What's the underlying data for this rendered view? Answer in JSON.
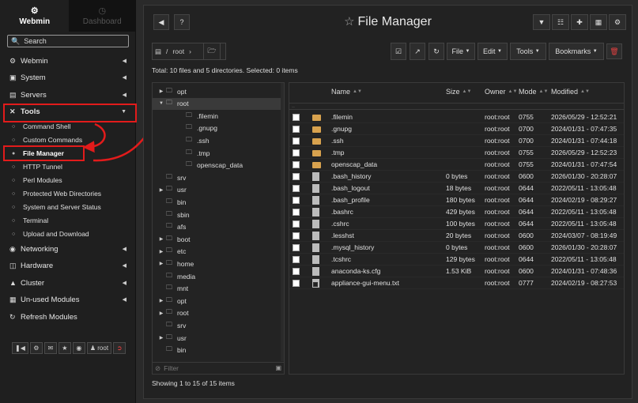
{
  "sidebar": {
    "tabs": [
      {
        "label": "Webmin",
        "icon": "webmin-icon"
      },
      {
        "label": "Dashboard",
        "icon": "dashboard-icon"
      }
    ],
    "search_placeholder": "Search",
    "menu": [
      {
        "label": "Webmin",
        "icon": "gear-icon"
      },
      {
        "label": "System",
        "icon": "monitor-icon"
      },
      {
        "label": "Servers",
        "icon": "server-icon"
      },
      {
        "label": "Tools",
        "icon": "tools-icon"
      },
      {
        "label": "Networking",
        "icon": "network-icon"
      },
      {
        "label": "Hardware",
        "icon": "hardware-icon"
      },
      {
        "label": "Cluster",
        "icon": "cluster-icon"
      },
      {
        "label": "Un-used Modules",
        "icon": "unused-icon"
      },
      {
        "label": "Refresh Modules",
        "icon": "refresh-icon"
      }
    ],
    "tools_items": [
      "Command Shell",
      "Custom Commands",
      "File Manager",
      "HTTP Tunnel",
      "Perl Modules",
      "Protected Web Directories",
      "System and Server Status",
      "Terminal",
      "Upload and Download"
    ],
    "bottom_user": "root"
  },
  "header": {
    "title": "File Manager"
  },
  "breadcrumb": {
    "path": "root"
  },
  "toolbar": {
    "file": "File",
    "edit": "Edit",
    "tools": "Tools",
    "bookmarks": "Bookmarks"
  },
  "summary": "Total: 10 files and 5 directories. Selected: 0 items",
  "tree": [
    {
      "label": "opt",
      "level": 0,
      "expandable": true
    },
    {
      "label": "root",
      "level": 0,
      "expanded": true,
      "selected": true
    },
    {
      "label": ".filemin",
      "level": 1
    },
    {
      "label": ".gnupg",
      "level": 1
    },
    {
      "label": ".ssh",
      "level": 1
    },
    {
      "label": ".tmp",
      "level": 1
    },
    {
      "label": "openscap_data",
      "level": 1
    },
    {
      "label": "srv",
      "level": 0
    },
    {
      "label": "usr",
      "level": 0,
      "expandable": true
    },
    {
      "label": "bin",
      "level": 0
    },
    {
      "label": "sbin",
      "level": 0
    },
    {
      "label": "afs",
      "level": 0
    },
    {
      "label": "boot",
      "level": 0,
      "expandable": true
    },
    {
      "label": "etc",
      "level": 0,
      "expandable": true
    },
    {
      "label": "home",
      "level": 0,
      "expandable": true
    },
    {
      "label": "media",
      "level": 0
    },
    {
      "label": "mnt",
      "level": 0
    },
    {
      "label": "opt",
      "level": 0,
      "expandable": true
    },
    {
      "label": "root",
      "level": 0,
      "expandable": true
    },
    {
      "label": "srv",
      "level": 0
    },
    {
      "label": "usr",
      "level": 0,
      "expandable": true
    },
    {
      "label": "bin",
      "level": 0
    }
  ],
  "tree_filter_placeholder": "Filter",
  "showing": "Showing 1 to 15 of 15 items",
  "columns": {
    "name": "Name",
    "size": "Size",
    "owner": "Owner",
    "mode": "Mode",
    "modified": "Modified"
  },
  "updir": "..",
  "files": [
    {
      "type": "folder",
      "name": ".filemin",
      "size": "",
      "owner": "root:root",
      "mode": "0755",
      "modified": "2026/05/29 - 12:52:21"
    },
    {
      "type": "folder",
      "name": ".gnupg",
      "size": "",
      "owner": "root:root",
      "mode": "0700",
      "modified": "2024/01/31 - 07:47:35"
    },
    {
      "type": "folder",
      "name": ".ssh",
      "size": "",
      "owner": "root:root",
      "mode": "0700",
      "modified": "2024/01/31 - 07:44:18"
    },
    {
      "type": "folder",
      "name": ".tmp",
      "size": "",
      "owner": "root:root",
      "mode": "0755",
      "modified": "2026/05/29 - 12:52:23"
    },
    {
      "type": "folder",
      "name": "openscap_data",
      "size": "",
      "owner": "root:root",
      "mode": "0755",
      "modified": "2024/01/31 - 07:47:54"
    },
    {
      "type": "file",
      "name": ".bash_history",
      "size": "0 bytes",
      "owner": "root:root",
      "mode": "0600",
      "modified": "2026/01/30 - 20:28:07"
    },
    {
      "type": "file",
      "name": ".bash_logout",
      "size": "18 bytes",
      "owner": "root:root",
      "mode": "0644",
      "modified": "2022/05/11 - 13:05:48"
    },
    {
      "type": "file",
      "name": ".bash_profile",
      "size": "180 bytes",
      "owner": "root:root",
      "mode": "0644",
      "modified": "2024/02/19 - 08:29:27"
    },
    {
      "type": "file",
      "name": ".bashrc",
      "size": "429 bytes",
      "owner": "root:root",
      "mode": "0644",
      "modified": "2022/05/11 - 13:05:48"
    },
    {
      "type": "file",
      "name": ".cshrc",
      "size": "100 bytes",
      "owner": "root:root",
      "mode": "0644",
      "modified": "2022/05/11 - 13:05:48"
    },
    {
      "type": "file",
      "name": ".lesshst",
      "size": "20 bytes",
      "owner": "root:root",
      "mode": "0600",
      "modified": "2024/03/07 - 08:19:49"
    },
    {
      "type": "file",
      "name": ".mysql_history",
      "size": "0 bytes",
      "owner": "root:root",
      "mode": "0600",
      "modified": "2026/01/30 - 20:28:07"
    },
    {
      "type": "file",
      "name": ".tcshrc",
      "size": "129 bytes",
      "owner": "root:root",
      "mode": "0644",
      "modified": "2022/05/11 - 13:05:48"
    },
    {
      "type": "file",
      "name": "anaconda-ks.cfg",
      "size": "1.53 KiB",
      "owner": "root:root",
      "mode": "0600",
      "modified": "2024/01/31 - 07:48:36"
    },
    {
      "type": "link",
      "name": "appliance-gui-menu.txt",
      "size": "",
      "owner": "root:root",
      "mode": "0777",
      "modified": "2024/02/19 - 08:27:53"
    }
  ],
  "colors": {
    "highlight": "#e21b1b",
    "folder": "#d8a24e"
  }
}
